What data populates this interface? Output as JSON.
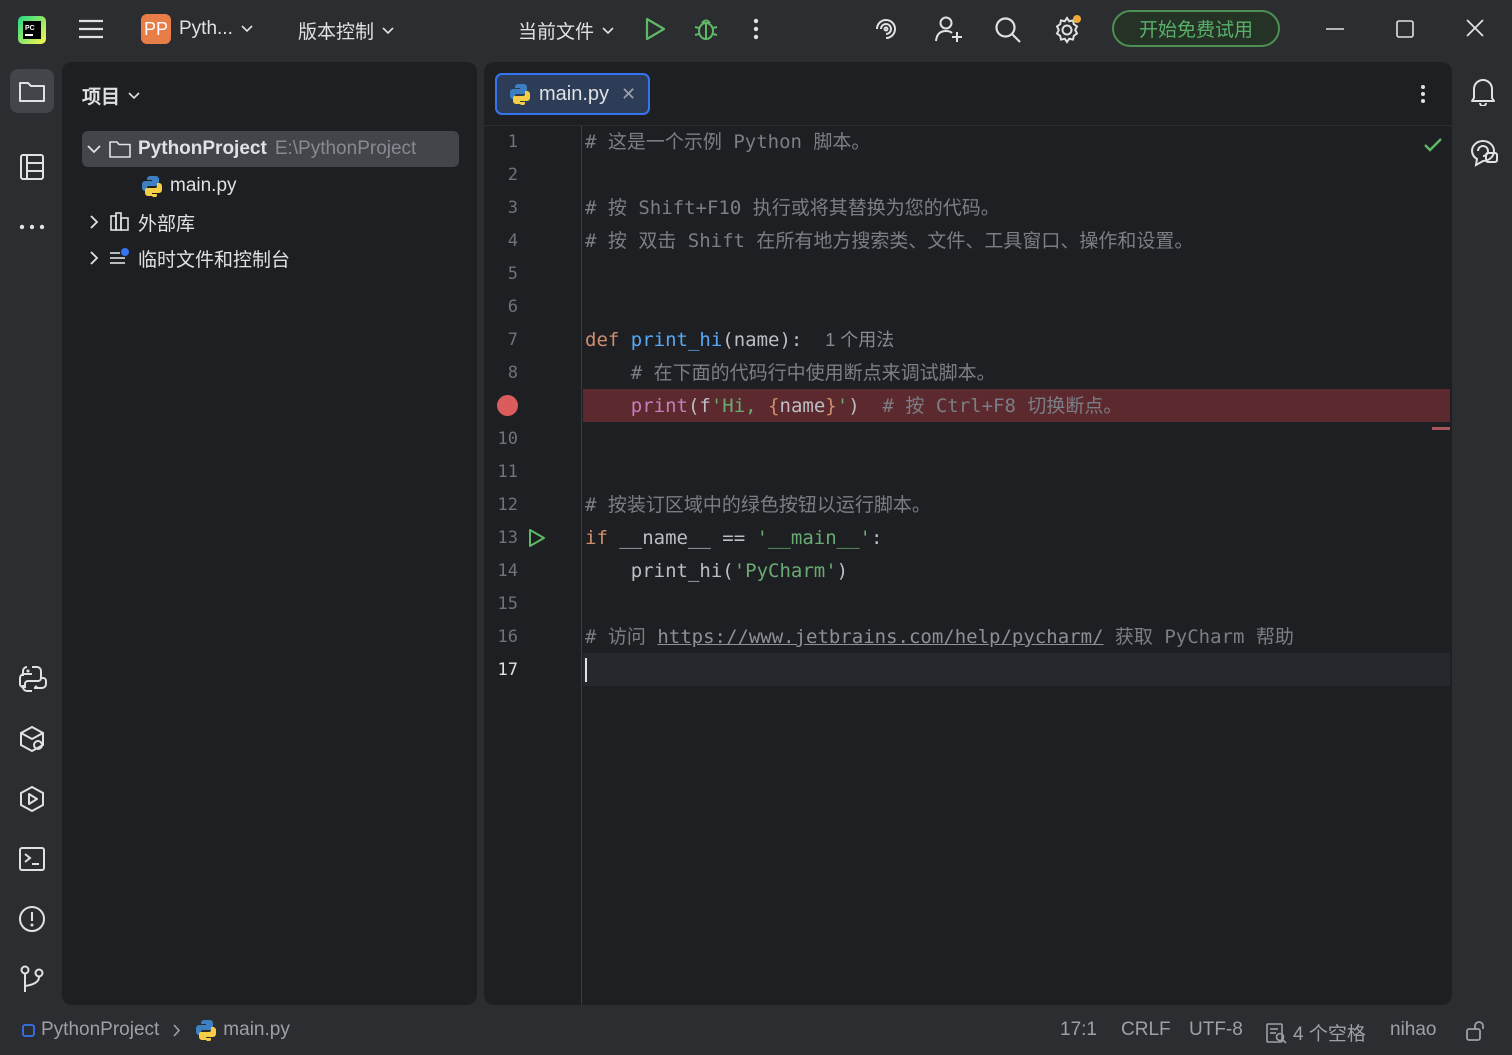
{
  "titlebar": {
    "project_badge": "PP",
    "project_name": "Pyth...",
    "vcs_label": "版本控制",
    "run_config": "当前文件",
    "trial_button": "开始免费试用"
  },
  "project_panel": {
    "header": "项目",
    "tree": [
      {
        "label": "PythonProject",
        "path": "E:\\PythonProject"
      },
      {
        "label": "main.py"
      },
      {
        "label": "外部库"
      },
      {
        "label": "临时文件和控制台"
      }
    ]
  },
  "editor": {
    "tab_label": "main.py",
    "line_numbers": [
      "1",
      "2",
      "3",
      "4",
      "5",
      "6",
      "7",
      "8",
      "9",
      "10",
      "11",
      "12",
      "13",
      "14",
      "15",
      "16",
      "17"
    ],
    "lines": {
      "l1": "# 这是一个示例 Python 脚本。",
      "l3": "# 按 Shift+F10 执行或将其替换为您的代码。",
      "l4": "# 按 双击 Shift 在所有地方搜索类、文件、工具窗口、操作和设置。",
      "l7_kw": "def",
      "l7_fn": "print_hi",
      "l7_rest": "(name):",
      "l7_hint": "1 个用法",
      "l8": "# 在下面的代码行中使用断点来调试脚本。",
      "l9_fn": "print",
      "l9_a": "(f",
      "l9_s1": "'Hi, ",
      "l9_b1": "{",
      "l9_name": "name",
      "l9_b2": "}",
      "l9_s2": "'",
      "l9_close": ")",
      "l9_com": "# 按 Ctrl+F8 切换断点。",
      "l12": "# 按装订区域中的绿色按钮以运行脚本。",
      "l13_kw": "if",
      "l13_mid": " __name__ == ",
      "l13_str": "'__main__'",
      "l13_end": ":",
      "l14_fn": "print_hi(",
      "l14_str": "'PyCharm'",
      "l14_end": ")",
      "l16_a": "# 访问 ",
      "l16_link": "https://www.jetbrains.com/help/pycharm/",
      "l16_b": " 获取 PyCharm 帮助"
    }
  },
  "statusbar": {
    "breadcrumb_project": "PythonProject",
    "breadcrumb_file": "main.py",
    "position": "17:1",
    "line_sep": "CRLF",
    "encoding": "UTF-8",
    "indent": "4 个空格",
    "interpreter": "nihao"
  },
  "colors": {
    "accent": "#3574f0",
    "run_green": "#5fb865",
    "breakpoint": "#db5c5c",
    "trial_green": "#58b069"
  }
}
